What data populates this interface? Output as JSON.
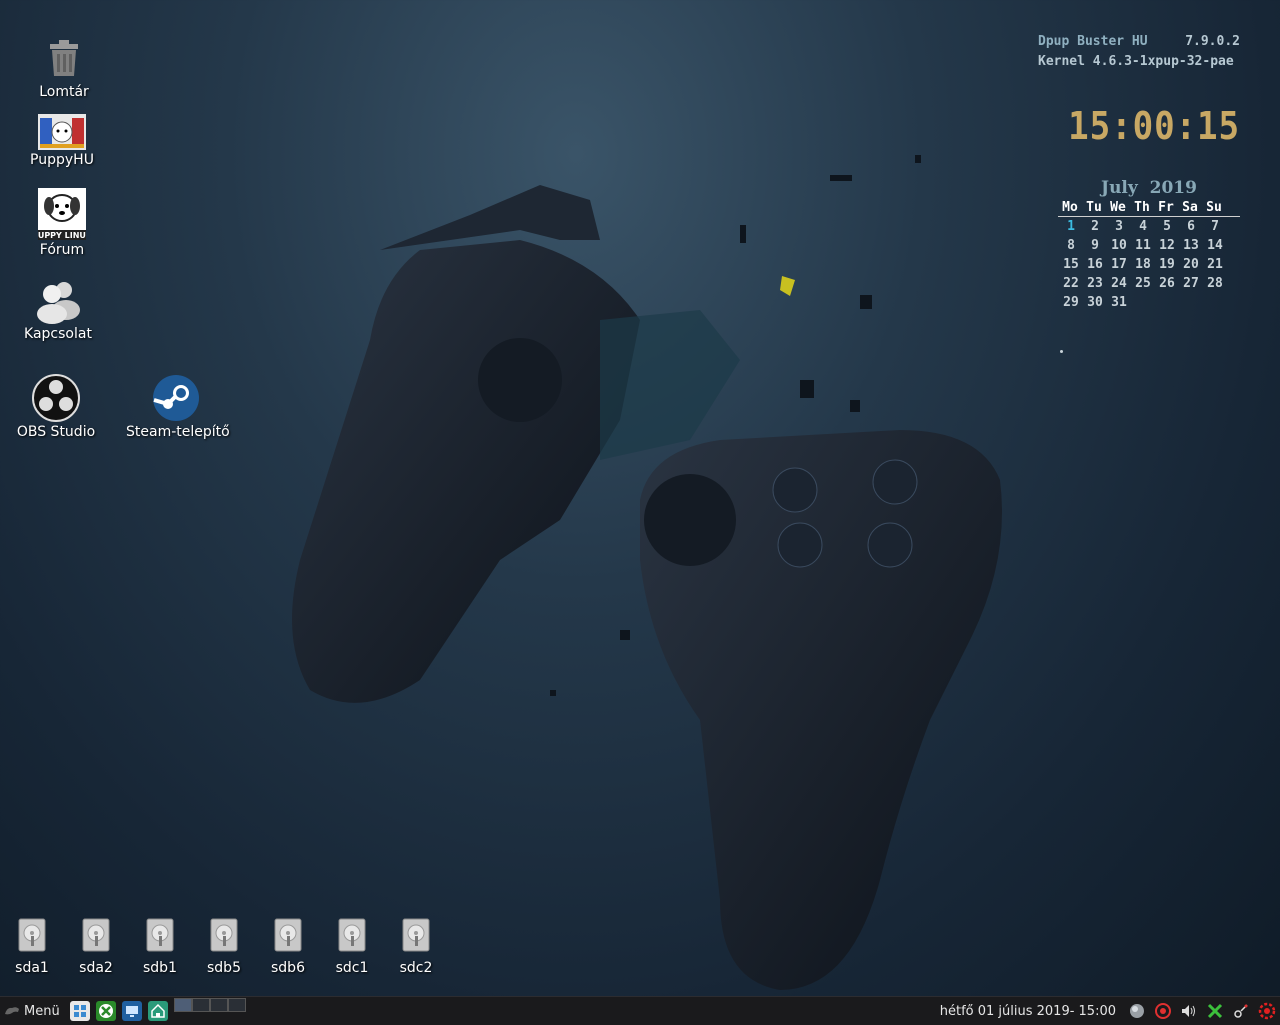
{
  "desktop": {
    "icons": [
      {
        "label": "Lomtár",
        "icon": "trash-icon"
      },
      {
        "label": "PuppyHU",
        "icon": "puppyhu-icon"
      },
      {
        "label": "Fórum",
        "icon": "puppy-linux-forum-icon",
        "logo_text": "PUPPY LINUX"
      },
      {
        "label": "Kapcsolat",
        "icon": "users-icon"
      },
      {
        "label": "OBS Studio",
        "icon": "obs-icon"
      },
      {
        "label": "Steam-telepítő",
        "icon": "steam-icon"
      }
    ],
    "drives": [
      "sda1",
      "sda2",
      "sdb1",
      "sdb5",
      "sdb6",
      "sdc1",
      "sdc2"
    ]
  },
  "conky": {
    "distro": "Dpup Buster HU",
    "version": "7.9.0.2",
    "kernel_label": "Kernel",
    "kernel": "4.6.3-1xpup-32-pae",
    "time": "15:00:15",
    "calendar": {
      "month": "July",
      "year": "2019",
      "weekdays": [
        "Mo",
        "Tu",
        "We",
        "Th",
        "Fr",
        "Sa",
        "Su"
      ],
      "days": [
        "1",
        "2",
        "3",
        "4",
        "5",
        "6",
        "7",
        "8",
        "9",
        "10",
        "11",
        "12",
        "13",
        "14",
        "15",
        "16",
        "17",
        "18",
        "19",
        "20",
        "21",
        "22",
        "23",
        "24",
        "25",
        "26",
        "27",
        "28",
        "29",
        "30",
        "31"
      ],
      "today": "1"
    }
  },
  "taskbar": {
    "menu_label": "Menü",
    "launchers": [
      "windows-icon",
      "xbox-icon",
      "monitor-icon",
      "home-folder-icon"
    ],
    "datetime": "hétfő 01 július 2019- 15:00",
    "tray": [
      "network-icon",
      "record-icon",
      "volume-icon",
      "x-icon",
      "settings-icon",
      "power-icon"
    ]
  },
  "colors": {
    "clock": "#c8a864",
    "today": "#3bbbe0",
    "taskbar": "#1a1a1c"
  }
}
